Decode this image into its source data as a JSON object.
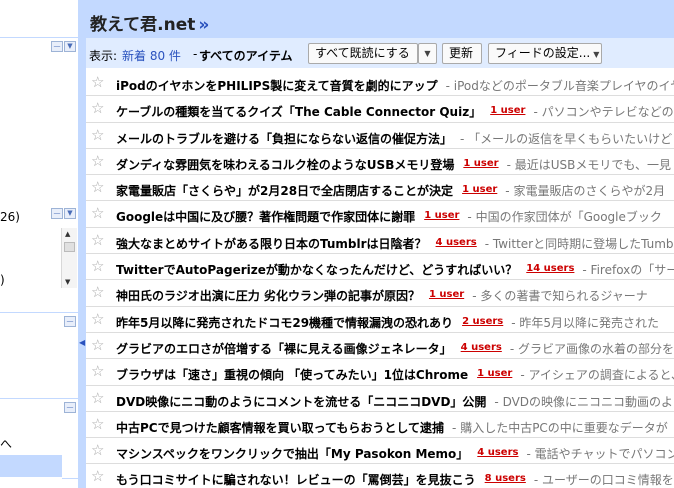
{
  "sidebar": {
    "partial_count": "26)",
    "partial_digit": ")",
    "partial_char": "へ"
  },
  "header": {
    "feed_title": "教えて君.net",
    "title_more": "»"
  },
  "toolbar": {
    "show_label": "表示:",
    "new_label": "新着 80 件",
    "separator": "-",
    "all_items_label": "すべてのアイテム",
    "mark_all_read": "すべて既読にする",
    "refresh": "更新",
    "feed_settings": "フィードの設定..."
  },
  "entries": [
    {
      "title": "iPodのイヤホンをPHILIPS製に変えて音質を劇的にアップ",
      "users": "",
      "snippet": "- iPodなどのポータブル音楽プレイヤのイヤホンを"
    },
    {
      "title": "ケーブルの種類を当てるクイズ「The Cable Connector Quiz」",
      "users": "1 user",
      "snippet": "- パソコンやテレビなどの裏側にある"
    },
    {
      "title": "メールのトラブルを避ける「負担にならない返信の催促方法」",
      "users": "",
      "snippet": "- 「メールの返信を早くもらいたいけど"
    },
    {
      "title": "ダンディな雰囲気を味わえるコルク栓のようなUSBメモリ登場",
      "users": "1 user",
      "snippet": "- 最近はUSBメモリでも、一見"
    },
    {
      "title": "家電量販店「さくらや」が2月28日で全店閉店することが決定",
      "users": "1 user",
      "snippet": "- 家電量販店のさくらやが2月"
    },
    {
      "title": "Googleは中国に及び腰？著作権問題で作家団体に謝罪",
      "users": "1 user",
      "snippet": "- 中国の作家団体が「Googleブック"
    },
    {
      "title": "強大なまとめサイトがある限り日本のTumblrは日陰者？",
      "users": "4 users",
      "snippet": "- Twitterと同時期に登場したTumblr"
    },
    {
      "title": "TwitterでAutoPagerizeが動かなくなったんだけど、どうすればいい？",
      "users": "14 users",
      "snippet": "- Firefoxの「サード"
    },
    {
      "title": "神田氏のラジオ出演に圧力 劣化ウラン弾の記事が原因？",
      "users": "1 user",
      "snippet": "- 多くの著書で知られるジャーナ"
    },
    {
      "title": "昨年5月以降に発売されたドコモ29機種で情報漏洩の恐れあり",
      "users": "2 users",
      "snippet": "- 昨年5月以降に発売された"
    },
    {
      "title": "グラビアのエロさが倍増する「裸に見える画像ジェネレータ」",
      "users": "4 users",
      "snippet": "- グラビア画像の水着の部分を"
    },
    {
      "title": "ブラウザは「速さ」重視の傾向 「使ってみたい」1位はChrome",
      "users": "1 user",
      "snippet": "- アイシェアの調査によると、ブラ"
    },
    {
      "title": "DVD映像にニコ動のようにコメントを流せる「ニコニコDVD」公開",
      "users": "",
      "snippet": "- DVDの映像にニコニコ動画のように"
    },
    {
      "title": "中古PCで見つけた顧客情報を買い取ってもらおうとして逮捕",
      "users": "",
      "snippet": "- 購入した中古PCの中に重要なデータが"
    },
    {
      "title": "マシンスペックをワンクリックで抽出「My Pasokon Memo」",
      "users": "4 users",
      "snippet": "- 電話やチャットでパソコン相談"
    },
    {
      "title": "もう口コミサイトに騙されない！レビューの「罵倒芸」を見抜こう",
      "users": "8 users",
      "snippet": "- ユーザーの口コミ情報を"
    }
  ],
  "colors": {
    "accent_blue": "#c3d9ff",
    "toolbar_blue": "#e0ecff",
    "user_count_red": "#cc0000",
    "link_blue": "#2a52be"
  }
}
